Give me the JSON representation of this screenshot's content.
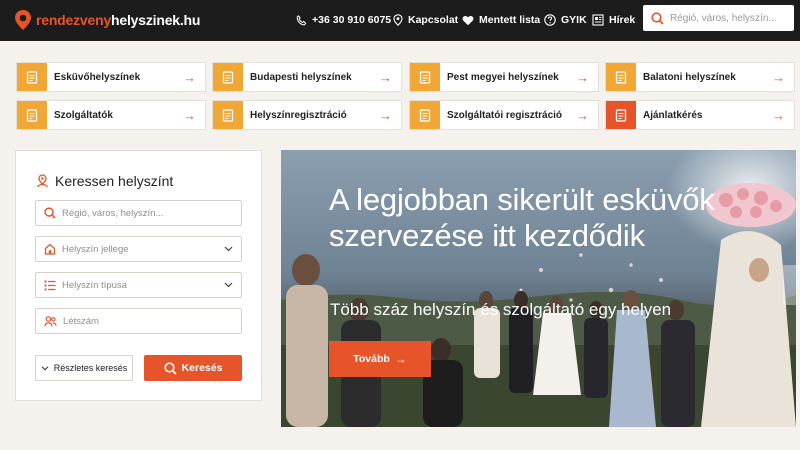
{
  "header": {
    "logo": {
      "part1": "rendezveny",
      "part2": "helyszinek.hu"
    },
    "nav": {
      "phone": "+36 30 910 6075",
      "contact": "Kapcsolat",
      "saved": "Mentett lista",
      "faq": "GYIK",
      "news": "Hírek"
    },
    "search_placeholder": "Régió, város, helyszín..."
  },
  "categories": [
    {
      "label": "Esküvőhelyszínek"
    },
    {
      "label": "Budapesti helyszínek"
    },
    {
      "label": "Pest megyei helyszínek"
    },
    {
      "label": "Balatoni helyszínek"
    },
    {
      "label": "Szolgáltatók"
    },
    {
      "label": "Helyszínregisztráció"
    },
    {
      "label": "Szolgáltatói regisztráció"
    },
    {
      "label": "Ajánlatkérés"
    }
  ],
  "search_panel": {
    "title": "Keressen helyszínt",
    "location_placeholder": "Régió, város, helyszín...",
    "venue_character": "Helyszín jellege",
    "venue_type": "Helyszín típusa",
    "headcount": "Létszám",
    "detailed_button": "Részletes keresés",
    "search_button": "Keresés"
  },
  "hero": {
    "title": "A legjobban sikerült esküvők szervezése itt kezdődik",
    "subtitle": "Több száz helyszín és szolgáltató egy helyen",
    "button": "Tovább",
    "button_arrow": "→"
  },
  "colors": {
    "accent": "#e8542a",
    "tile_icon": "#f0a736",
    "topbar": "#1c1c1c"
  }
}
